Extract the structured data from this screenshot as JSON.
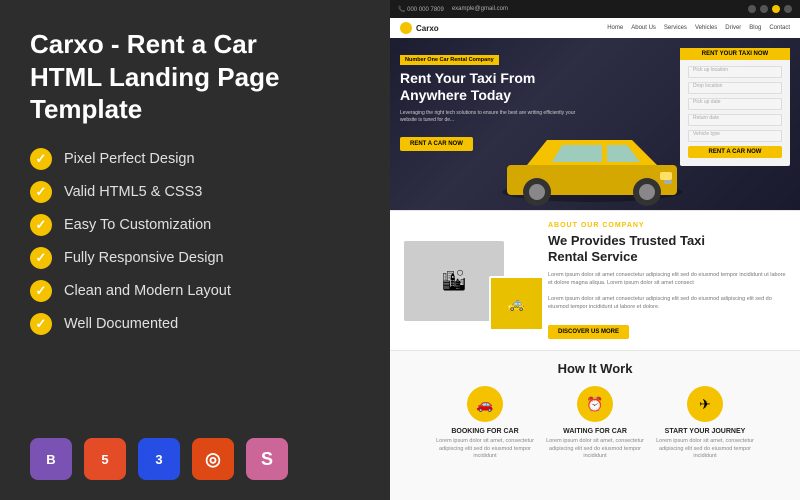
{
  "left": {
    "title": "Carxo - Rent a Car\nHTML Landing Page\nTemplate",
    "features": [
      "Pixel Perfect Design",
      "Valid HTML5 & CSS3",
      "Easy To Customization",
      "Fully Responsive Design",
      "Clean and Modern Layout",
      "Well Documented"
    ],
    "tech_badges": [
      {
        "label": "B",
        "class": "badge-bootstrap",
        "name": "bootstrap"
      },
      {
        "label": "5",
        "class": "badge-html",
        "name": "html5"
      },
      {
        "label": "3",
        "class": "badge-css",
        "name": "css3"
      },
      {
        "label": "◎",
        "class": "badge-codeigniter",
        "name": "codeigniter"
      },
      {
        "label": "S",
        "class": "badge-sass",
        "name": "sass"
      }
    ]
  },
  "preview": {
    "topbar": {
      "phone": "📞 000 000 7809",
      "email": "example@gmail.com"
    },
    "nav": {
      "logo": "Carxo",
      "links": [
        "Home",
        "About Us",
        "Services",
        "Vehicles",
        "Driver",
        "Blog",
        "Contact"
      ]
    },
    "hero": {
      "badge": "Number One Car Rental Company",
      "title": "Rent Your Taxi From\nAnywhere Today",
      "description": "Leveraging the right tech solutions to ensure the best are writing efficiently your website is tuned for de...",
      "cta": "RENT A CAR NOW"
    },
    "form": {
      "title": "RENT YOUR TAXI NOW",
      "fields": [
        "Pick up location",
        "Drop location",
        "Pick up date",
        "Return date",
        "Vehicle type"
      ],
      "submit": "RENT A CAR NOW"
    },
    "about": {
      "label_prefix": "ABOUT",
      "label_highlight": "OUR COMPANY",
      "title": "We Provides Trusted Taxi\nRental Service",
      "description1": "Lorem ipsum dolor sit amet consectetur adipiscing elit sed do eiusmod tempor incididunt ut labore et dolore magna aliqua. Lorem ipsum dolor sit amet consect",
      "description2": "Lorem ipsum dolor sit amet consectetur adipiscing elit sed do eiusmod adipiscing elit sed do eiusmod tempor incididunt ut labore et dolore.",
      "cta": "DISCOVER US MORE"
    },
    "how": {
      "title": "How It Work",
      "steps": [
        {
          "icon": "🚗",
          "title": "BOOKING FOR CAR",
          "desc": "Lorem ipsum dolor sit amet, consectetur adipiscing elit sed do eiusmod tempor incididunt"
        },
        {
          "icon": "⏰",
          "title": "WAITING FOR CAR",
          "desc": "Lorem ipsum dolor sit amet, consectetur adipiscing elit sed do eiusmod tempor incididunt"
        },
        {
          "icon": "✈",
          "title": "START YOUR JOURNEY",
          "desc": "Lorem ipsum dolor sit amet, consectetur adipiscing elit sed do eiusmod tempor incididunt"
        }
      ]
    }
  }
}
